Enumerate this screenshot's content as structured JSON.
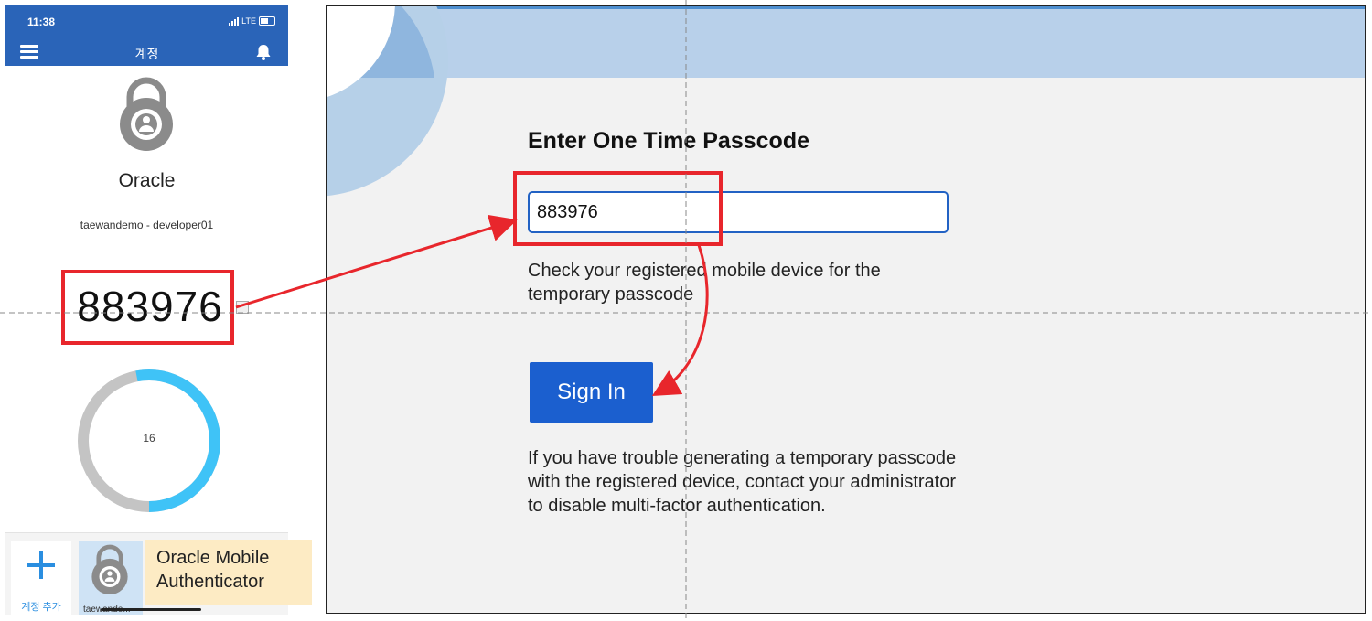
{
  "phone": {
    "status": {
      "time": "11:38",
      "network": "LTE"
    },
    "appbar": {
      "title": "계정",
      "menu_icon": "hamburger-menu-icon",
      "bell_icon": "bell-icon"
    },
    "account": {
      "name": "Oracle",
      "subtitle": "taewandemo - developer01",
      "icon": "lock-icon"
    },
    "otp_code": "883976",
    "timer": {
      "seconds_left": "16",
      "remaining_fraction": 0.53
    },
    "bottom": {
      "add_label": "계정 추가",
      "account_tile_label": "taewande..."
    }
  },
  "callout": {
    "line1": "Oracle Mobile",
    "line2": "Authenticator"
  },
  "login": {
    "title": "Enter One Time Passcode",
    "input_value": "883976",
    "help_text": "Check your registered mobile device for the temporary passcode",
    "sign_in_label": "Sign In",
    "trouble_text": "If you have trouble generating a temporary passcode with the registered device, contact your administrator to disable multi-factor authentication."
  },
  "colors": {
    "brand_blue": "#2a64b8",
    "button_blue": "#1b5fcf",
    "highlight_red": "#e8262c",
    "timer_blue": "#3fc3f7",
    "timer_gray": "#c4c4c4",
    "callout_bg": "#fdebc4"
  }
}
